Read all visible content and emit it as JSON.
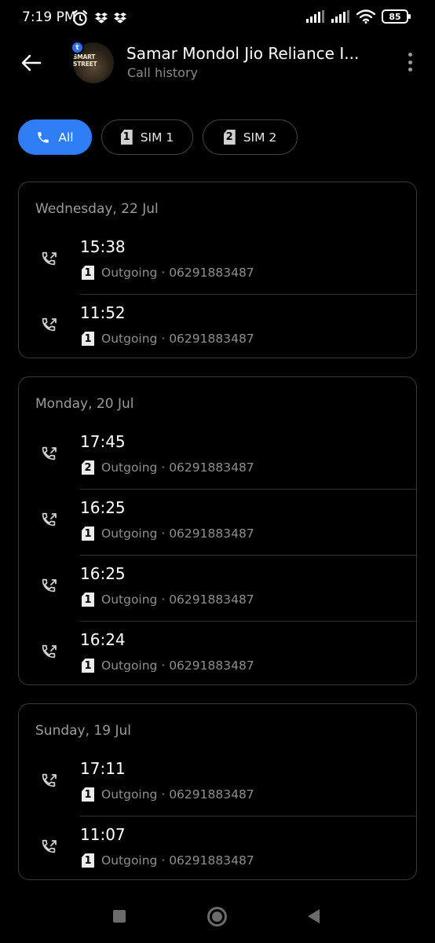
{
  "status_bar": {
    "time": "7:19 PM",
    "battery": "85",
    "icons_left": [
      "alarm-icon",
      "dropbox-icon",
      "dropbox-icon"
    ],
    "icons_right": [
      "signal-icon",
      "signal-icon",
      "wifi-icon",
      "battery-icon"
    ]
  },
  "header": {
    "back_icon": "arrow-left-icon",
    "avatar_text": "SMART STREET",
    "avatar_badge": "t",
    "name": "Samar Mondol Jio Reliance I...",
    "subtitle": "Call history",
    "menu_icon": "more-vertical-icon"
  },
  "filters": [
    {
      "label": "All",
      "icon": "phone-icon",
      "active": true
    },
    {
      "label": "SIM 1",
      "sim": "1",
      "active": false
    },
    {
      "label": "SIM 2",
      "sim": "2",
      "active": false
    }
  ],
  "groups": [
    {
      "day": "Wednesday, 22 Jul",
      "calls": [
        {
          "time": "15:38",
          "sim": "1",
          "type": "Outgoing",
          "number": "06291883487"
        },
        {
          "time": "11:52",
          "sim": "1",
          "type": "Outgoing",
          "number": "06291883487"
        }
      ]
    },
    {
      "day": "Monday, 20 Jul",
      "calls": [
        {
          "time": "17:45",
          "sim": "2",
          "type": "Outgoing",
          "number": "06291883487"
        },
        {
          "time": "16:25",
          "sim": "1",
          "type": "Outgoing",
          "number": "06291883487"
        },
        {
          "time": "16:25",
          "sim": "1",
          "type": "Outgoing",
          "number": "06291883487"
        },
        {
          "time": "16:24",
          "sim": "1",
          "type": "Outgoing",
          "number": "06291883487"
        }
      ]
    },
    {
      "day": "Sunday, 19 Jul",
      "calls": [
        {
          "time": "17:11",
          "sim": "1",
          "type": "Outgoing",
          "number": "06291883487"
        },
        {
          "time": "11:07",
          "sim": "1",
          "type": "Outgoing",
          "number": "06291883487"
        }
      ]
    }
  ],
  "separator": " · ",
  "call_icon": "outgoing-call-icon",
  "nav": [
    "recents-square-icon",
    "home-circle-icon",
    "back-triangle-icon"
  ],
  "colors": {
    "accent": "#2f7ef6",
    "background": "#000000",
    "muted": "#8e8e8e"
  }
}
